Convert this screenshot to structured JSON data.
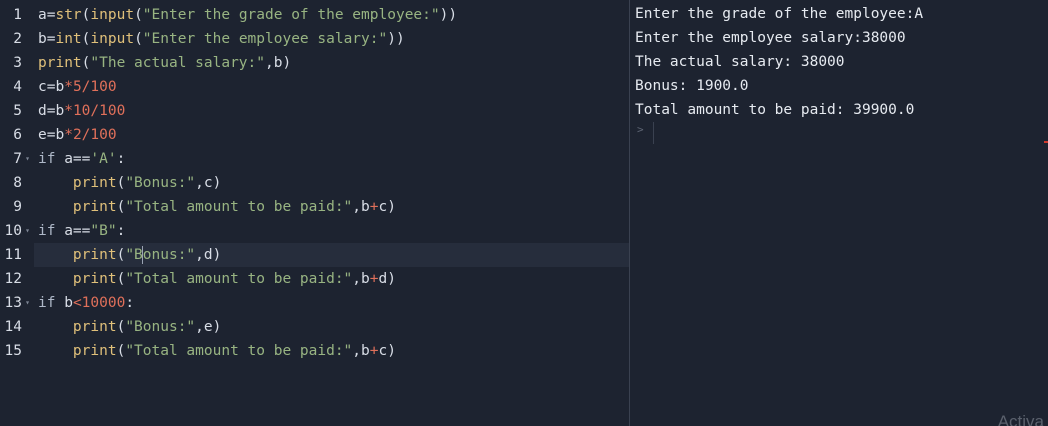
{
  "editor": {
    "lines": [
      {
        "num": "1",
        "fold": ""
      },
      {
        "num": "2",
        "fold": ""
      },
      {
        "num": "3",
        "fold": ""
      },
      {
        "num": "4",
        "fold": ""
      },
      {
        "num": "5",
        "fold": ""
      },
      {
        "num": "6",
        "fold": ""
      },
      {
        "num": "7",
        "fold": "▾"
      },
      {
        "num": "8",
        "fold": ""
      },
      {
        "num": "9",
        "fold": ""
      },
      {
        "num": "10",
        "fold": "▾"
      },
      {
        "num": "11",
        "fold": ""
      },
      {
        "num": "12",
        "fold": ""
      },
      {
        "num": "13",
        "fold": "▾"
      },
      {
        "num": "14",
        "fold": ""
      },
      {
        "num": "15",
        "fold": ""
      }
    ],
    "code": {
      "l1": {
        "a": "a=",
        "f1": "str",
        "p1": "(",
        "f2": "input",
        "p2": "(",
        "s": "\"Enter the grade of the employee:\"",
        "p3": "))"
      },
      "l2": {
        "a": "b=",
        "f1": "int",
        "p1": "(",
        "f2": "input",
        "p2": "(",
        "s": "\"Enter the employee salary:\"",
        "p3": "))"
      },
      "l3": {
        "f": "print",
        "p1": "(",
        "s": "\"The actual salary:\"",
        "rest": ",b)"
      },
      "l4": {
        "a": "c=b",
        "op": "*",
        "n": "5/100"
      },
      "l5": {
        "a": "d=b",
        "op": "*",
        "n": "10/100"
      },
      "l6": {
        "a": "e=b",
        "op": "*",
        "n": "2/100"
      },
      "l7": {
        "kw": "if",
        "a": " a==",
        "s": "'A'",
        "rest": ":"
      },
      "l8": {
        "f": "print",
        "p1": "(",
        "s": "\"Bonus:\"",
        "rest": ",c)"
      },
      "l9": {
        "f": "print",
        "p1": "(",
        "s": "\"Total amount to be paid:\"",
        "mid": ",b",
        "op": "+",
        "rest": "c)"
      },
      "l10": {
        "kw": "if",
        "a": " a==",
        "s": "\"B\"",
        "rest": ":"
      },
      "l11": {
        "f": "print",
        "p1": "(",
        "s1": "\"B",
        "s2": "onus:\"",
        "rest": ",d)"
      },
      "l12": {
        "f": "print",
        "p1": "(",
        "s": "\"Total amount to be paid:\"",
        "mid": ",b",
        "op": "+",
        "rest": "d)"
      },
      "l13": {
        "kw": "if",
        "a": " b",
        "op": "<",
        "n": "10000",
        "rest": ":"
      },
      "l14": {
        "f": "print",
        "p1": "(",
        "s": "\"Bonus:\"",
        "rest": ",e)"
      },
      "l15": {
        "f": "print",
        "p1": "(",
        "s": "\"Total amount to be paid:\"",
        "mid": ",b",
        "op": "+",
        "rest": "c)"
      }
    }
  },
  "console": {
    "output": [
      "Enter the grade of the employee:A",
      "Enter the employee salary:38000",
      "The actual salary: 38000",
      "Bonus: 1900.0",
      "Total amount to be paid: 39900.0"
    ],
    "prompt": ">"
  },
  "watermark": "Activa",
  "colors": {
    "background": "#1d2330",
    "string": "#98b482",
    "number": "#e0705a",
    "function": "#e0c07a",
    "text": "#d8dde6"
  }
}
